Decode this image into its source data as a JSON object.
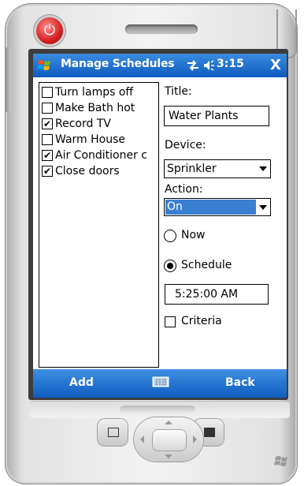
{
  "window": {
    "title": "Manage Schedules",
    "clock": "3:15",
    "close_label": "X"
  },
  "list": {
    "items": [
      {
        "label": "Turn lamps off",
        "checked": false
      },
      {
        "label": "Make Bath hot",
        "checked": false
      },
      {
        "label": "Record TV",
        "checked": true
      },
      {
        "label": "Warm House",
        "checked": false
      },
      {
        "label": "Air Conditioner c",
        "checked": true
      },
      {
        "label": "Close doors",
        "checked": true
      }
    ]
  },
  "form": {
    "title_label": "Title:",
    "title_value": "Water Plants",
    "device_label": "Device:",
    "device_value": "Sprinkler",
    "action_label": "Action:",
    "action_value": "On",
    "now_label": "Now",
    "schedule_label": "Schedule",
    "selected_timing": "Schedule",
    "time_value": "5:25:00 AM",
    "criteria_label": "Criteria",
    "criteria_checked": false
  },
  "softkeys": {
    "left": "Add",
    "right": "Back"
  },
  "colors": {
    "titlebar": "#0e5bbf",
    "selection": "#3b7fd0",
    "power": "#d62020"
  },
  "icons": {
    "start": "windows-flag-icon",
    "connectivity": "connectivity-icon",
    "volume": "speaker-icon",
    "keyboard": "keyboard-icon"
  }
}
